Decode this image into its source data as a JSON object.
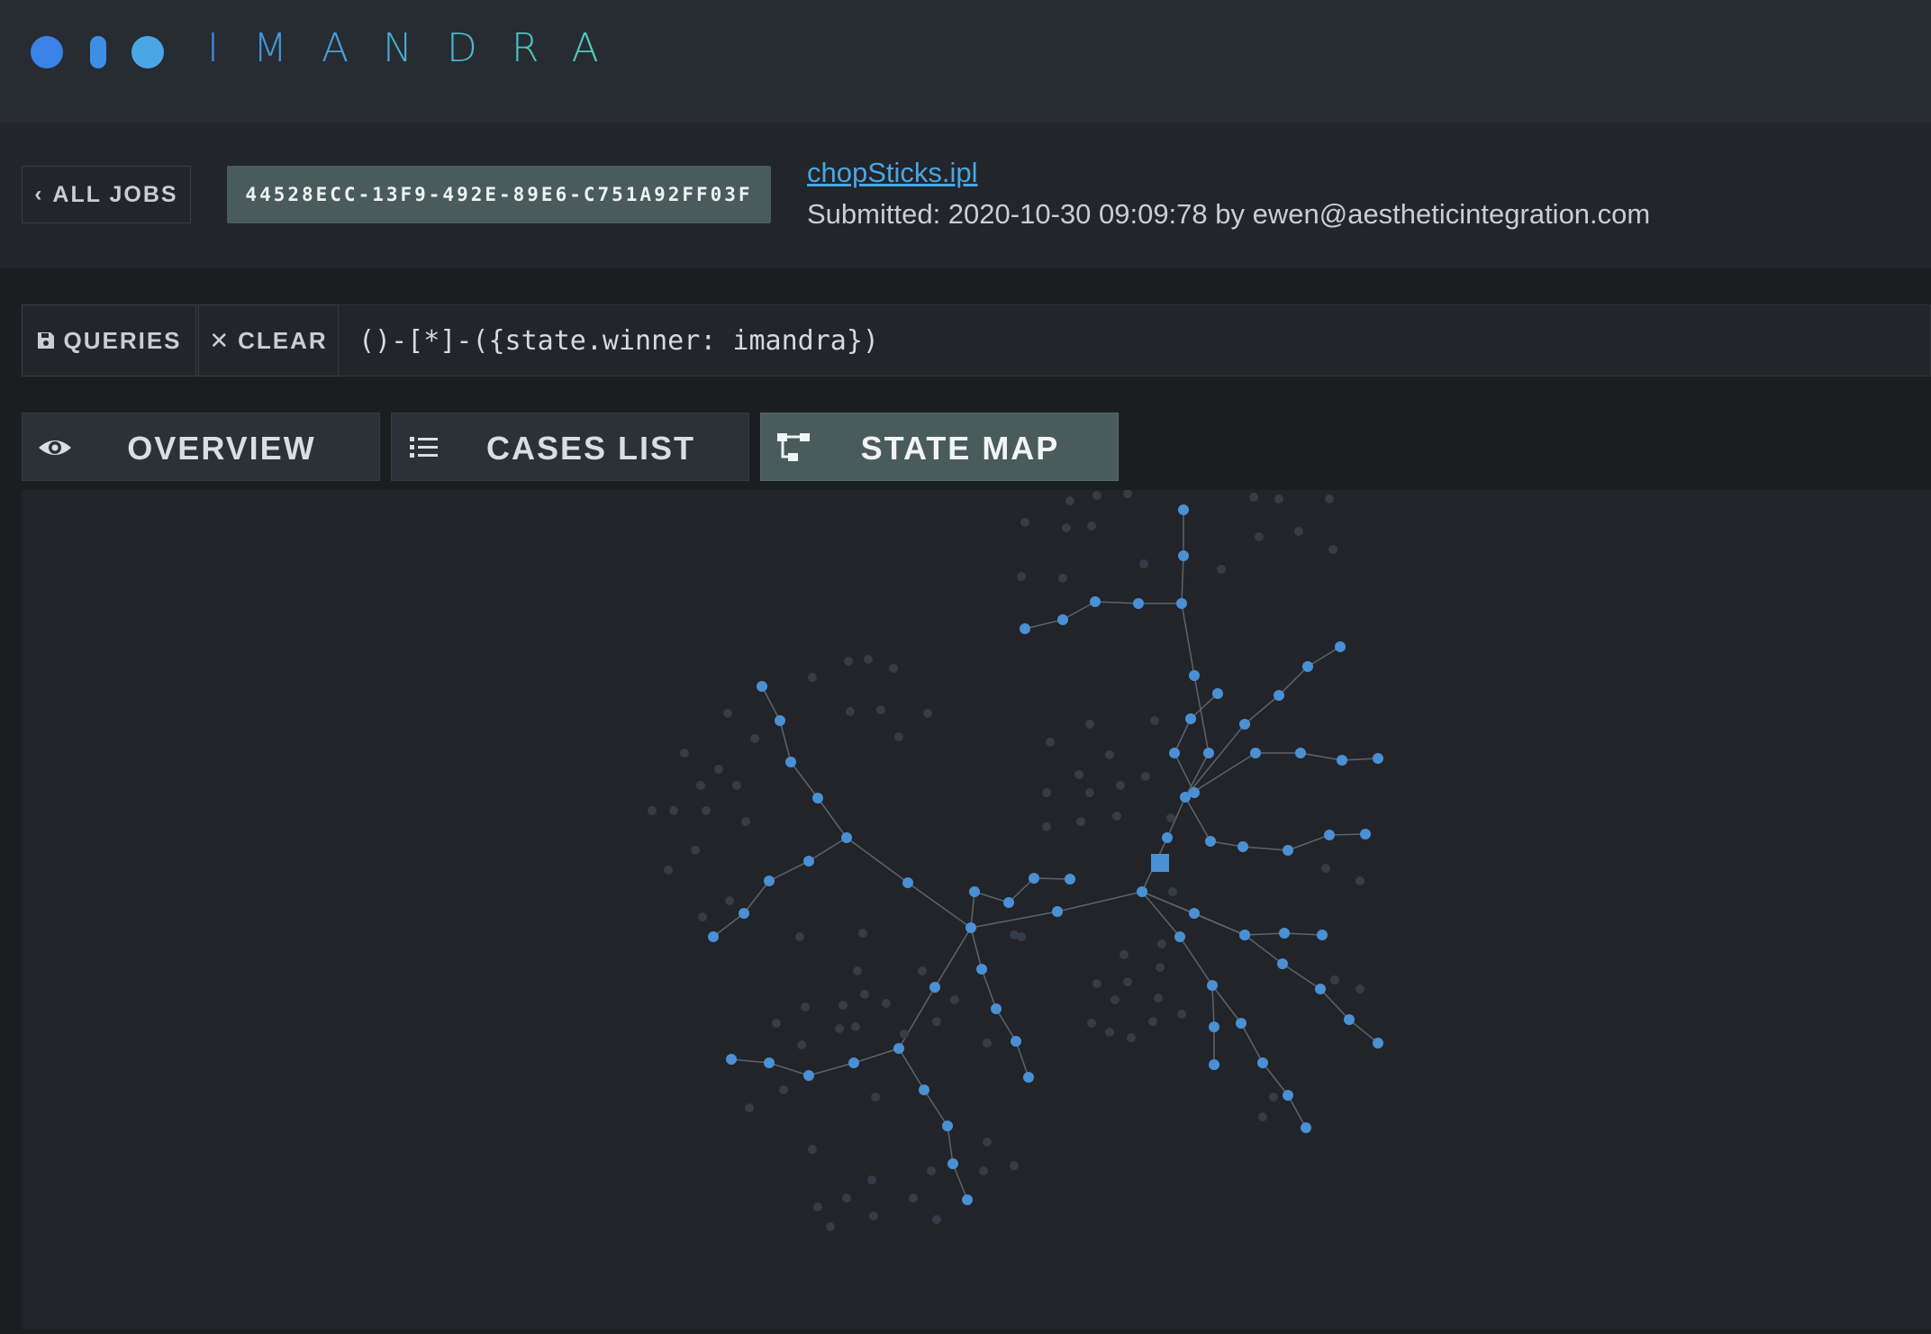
{
  "brand": {
    "name": "IMANDRA",
    "colors": {
      "dot1": "#3b82e8",
      "dot2": "#3d8fe6",
      "dot3": "#4aa6e6",
      "text_start": "#3d8fe6",
      "text_end": "#55d3b6"
    }
  },
  "job": {
    "back_label": "ALL JOBS",
    "back_icon": "chevron-left-icon",
    "id": "44528ECC-13F9-492E-89E6-C751A92FF03F",
    "file_name": "chopSticks.ipl",
    "submitted": "Submitted: 2020-10-30 09:09:78 by ewen@aestheticintegration.com"
  },
  "query": {
    "queries_label": "QUERIES",
    "queries_icon": "save-icon",
    "clear_label": "CLEAR",
    "clear_icon": "close-icon",
    "value": "()-[*]-({state.winner: imandra})"
  },
  "tabs": [
    {
      "label": "OVERVIEW",
      "icon": "eye-icon",
      "active": false
    },
    {
      "label": "CASES LIST",
      "icon": "list-icon",
      "active": false
    },
    {
      "label": "STATE MAP",
      "icon": "tree-icon",
      "active": true
    }
  ],
  "state_map": {
    "colors": {
      "active_node": "#4a90d4",
      "inactive_node": "#363d47",
      "edge": "#5d646c",
      "root_marker": "#4a90d4"
    }
  }
}
